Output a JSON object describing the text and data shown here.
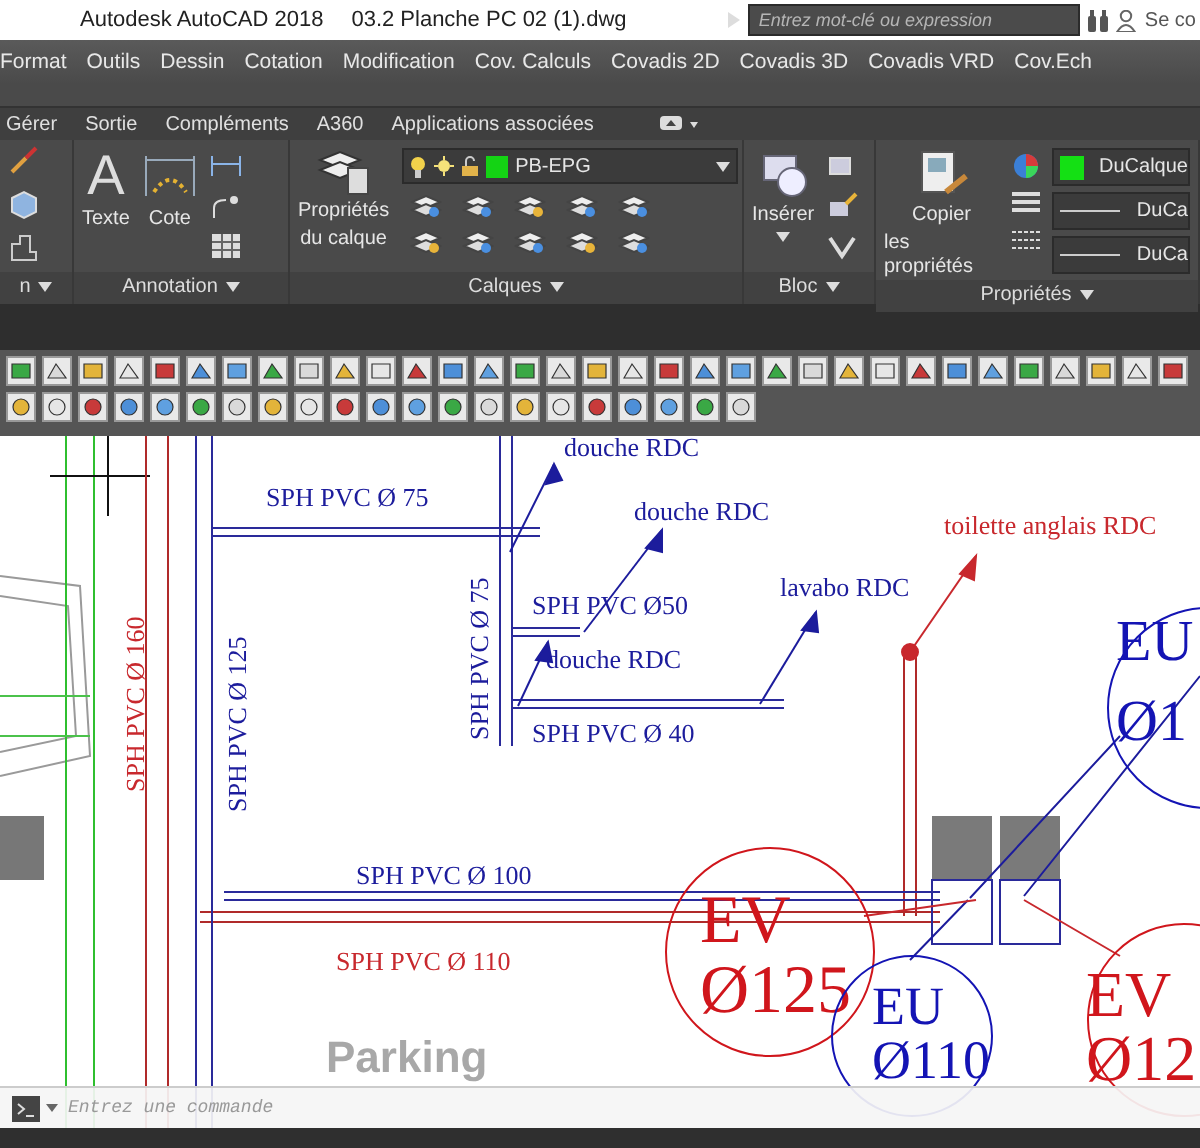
{
  "title_bar": {
    "app_name": "Autodesk AutoCAD 2018",
    "file_name": "03.2 Planche PC 02 (1).dwg",
    "search": {
      "placeholder": "Entrez mot-clé ou expression"
    },
    "user": "Se co"
  },
  "menu_bar": [
    "Format",
    "Outils",
    "Dessin",
    "Cotation",
    "Modification",
    "Cov. Calculs",
    "Covadis 2D",
    "Covadis 3D",
    "Covadis VRD",
    "Cov.Ech"
  ],
  "ribbon_tabs": [
    {
      "label": "Gérer",
      "selected": false
    },
    {
      "label": "Sortie",
      "selected": false
    },
    {
      "label": "Compléments",
      "selected": false
    },
    {
      "label": "A360",
      "selected": false
    },
    {
      "label": "Applications associées",
      "selected": false
    }
  ],
  "ribbon_panels": [
    {
      "kind": "modify",
      "title": "n"
    },
    {
      "kind": "annotation",
      "title": "Annotation",
      "glyph": "A",
      "buttons": [
        [
          "Texte"
        ],
        [
          "Cote"
        ]
      ]
    },
    {
      "kind": "layers",
      "title": "Calques",
      "buttons": [
        [
          "Propriétés",
          "du calque"
        ]
      ],
      "layer": "PB-EPG"
    },
    {
      "kind": "block",
      "title": "Bloc",
      "buttons": [
        [
          "Insérer"
        ]
      ]
    },
    {
      "kind": "properties",
      "title": "Propriétés",
      "buttons": [
        [
          "Copier",
          "les propriétés"
        ]
      ],
      "values": [
        "DuCalque",
        "DuCa",
        "DuCa"
      ]
    }
  ],
  "drawing": {
    "labels": [
      {
        "text": "douche RDC",
        "color": "#1c1c9c"
      },
      {
        "text": "SPH PVC Ø 75",
        "color": "#1c1c9c"
      },
      {
        "text": "douche RDC",
        "color": "#1c1c9c"
      },
      {
        "text": "toilette anglais RDC",
        "color": "#c8282d"
      },
      {
        "text": "lavabo RDC",
        "color": "#1c1c9c"
      },
      {
        "text": "SPH PVC Ø50",
        "color": "#1c1c9c"
      },
      {
        "text": "douche RDC",
        "color": "#1c1c9c"
      },
      {
        "text": "SPH PVC Ø 40",
        "color": "#1c1c9c"
      },
      {
        "text": "SPH PVC Ø 75",
        "color": "#1c1c9c"
      },
      {
        "text": "SPH PVC Ø 125",
        "color": "#1c1c9c"
      },
      {
        "text": "SPH PVC Ø 160",
        "color": "#c8282d"
      },
      {
        "text": "SPH PVC Ø 100",
        "color": "#1c1c9c"
      },
      {
        "text": "SPH PVC Ø 110",
        "color": "#c8282d"
      }
    ],
    "tags": [
      {
        "line_1": "EU",
        "line_2": "Ø1",
        "color": "#1414b4"
      },
      {
        "line_1": "EV",
        "line_2": "Ø125",
        "color": "#d0161c"
      },
      {
        "line_1": "EU",
        "line_2": "Ø110",
        "color": "#1414b4"
      },
      {
        "line_1": "EV",
        "line_2": "Ø12",
        "color": "#d0161c"
      }
    ],
    "faded_label": "Parking"
  },
  "command_line": {
    "placeholder": "Entrez une commande"
  }
}
